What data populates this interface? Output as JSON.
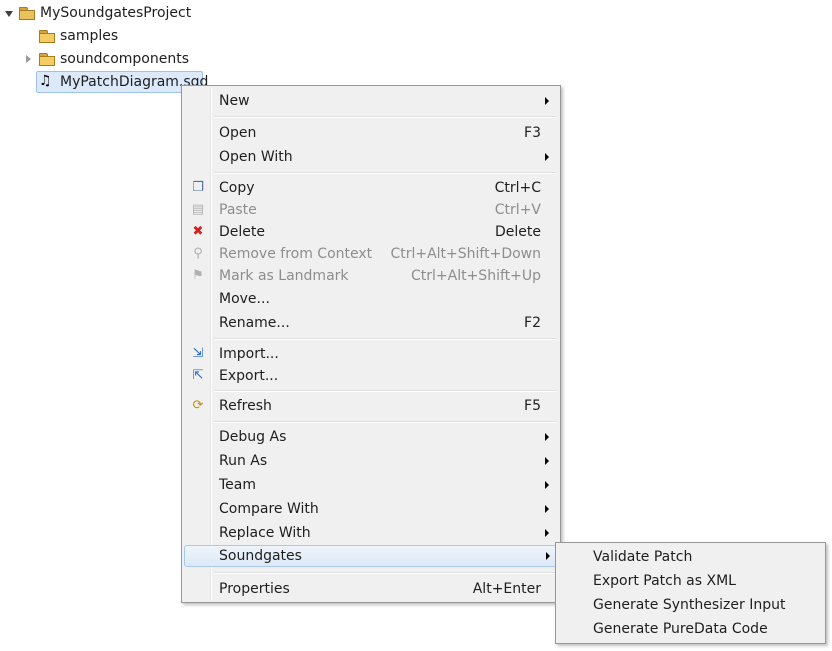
{
  "tree": {
    "project": "MySoundgatesProject",
    "children": [
      {
        "label": "samples"
      },
      {
        "label": "soundcomponents"
      },
      {
        "label": "MyPatchDiagram.sgd"
      }
    ]
  },
  "menu": {
    "items": [
      {
        "label": "New",
        "shortcut": ""
      },
      {
        "label": "Open",
        "shortcut": "F3"
      },
      {
        "label": "Open With",
        "shortcut": ""
      },
      {
        "label": "Copy",
        "shortcut": "Ctrl+C"
      },
      {
        "label": "Paste",
        "shortcut": "Ctrl+V"
      },
      {
        "label": "Delete",
        "shortcut": "Delete"
      },
      {
        "label": "Remove from Context",
        "shortcut": "Ctrl+Alt+Shift+Down"
      },
      {
        "label": "Mark as Landmark",
        "shortcut": "Ctrl+Alt+Shift+Up"
      },
      {
        "label": "Move...",
        "shortcut": ""
      },
      {
        "label": "Rename...",
        "shortcut": "F2"
      },
      {
        "label": "Import...",
        "shortcut": ""
      },
      {
        "label": "Export...",
        "shortcut": ""
      },
      {
        "label": "Refresh",
        "shortcut": "F5"
      },
      {
        "label": "Debug As",
        "shortcut": ""
      },
      {
        "label": "Run As",
        "shortcut": ""
      },
      {
        "label": "Team",
        "shortcut": ""
      },
      {
        "label": "Compare With",
        "shortcut": ""
      },
      {
        "label": "Replace With",
        "shortcut": ""
      },
      {
        "label": "Soundgates",
        "shortcut": ""
      },
      {
        "label": "Properties",
        "shortcut": "Alt+Enter"
      }
    ]
  },
  "submenu": {
    "items": [
      {
        "label": "Validate Patch"
      },
      {
        "label": "Export Patch as XML"
      },
      {
        "label": "Generate Synthesizer Input"
      },
      {
        "label": "Generate PureData Code"
      }
    ]
  },
  "colors": {
    "highlight": "#dde9f7",
    "menu_bg": "#f0f0f0",
    "disabled_text": "#8d8d8d",
    "selection": "#dbe9fb"
  }
}
